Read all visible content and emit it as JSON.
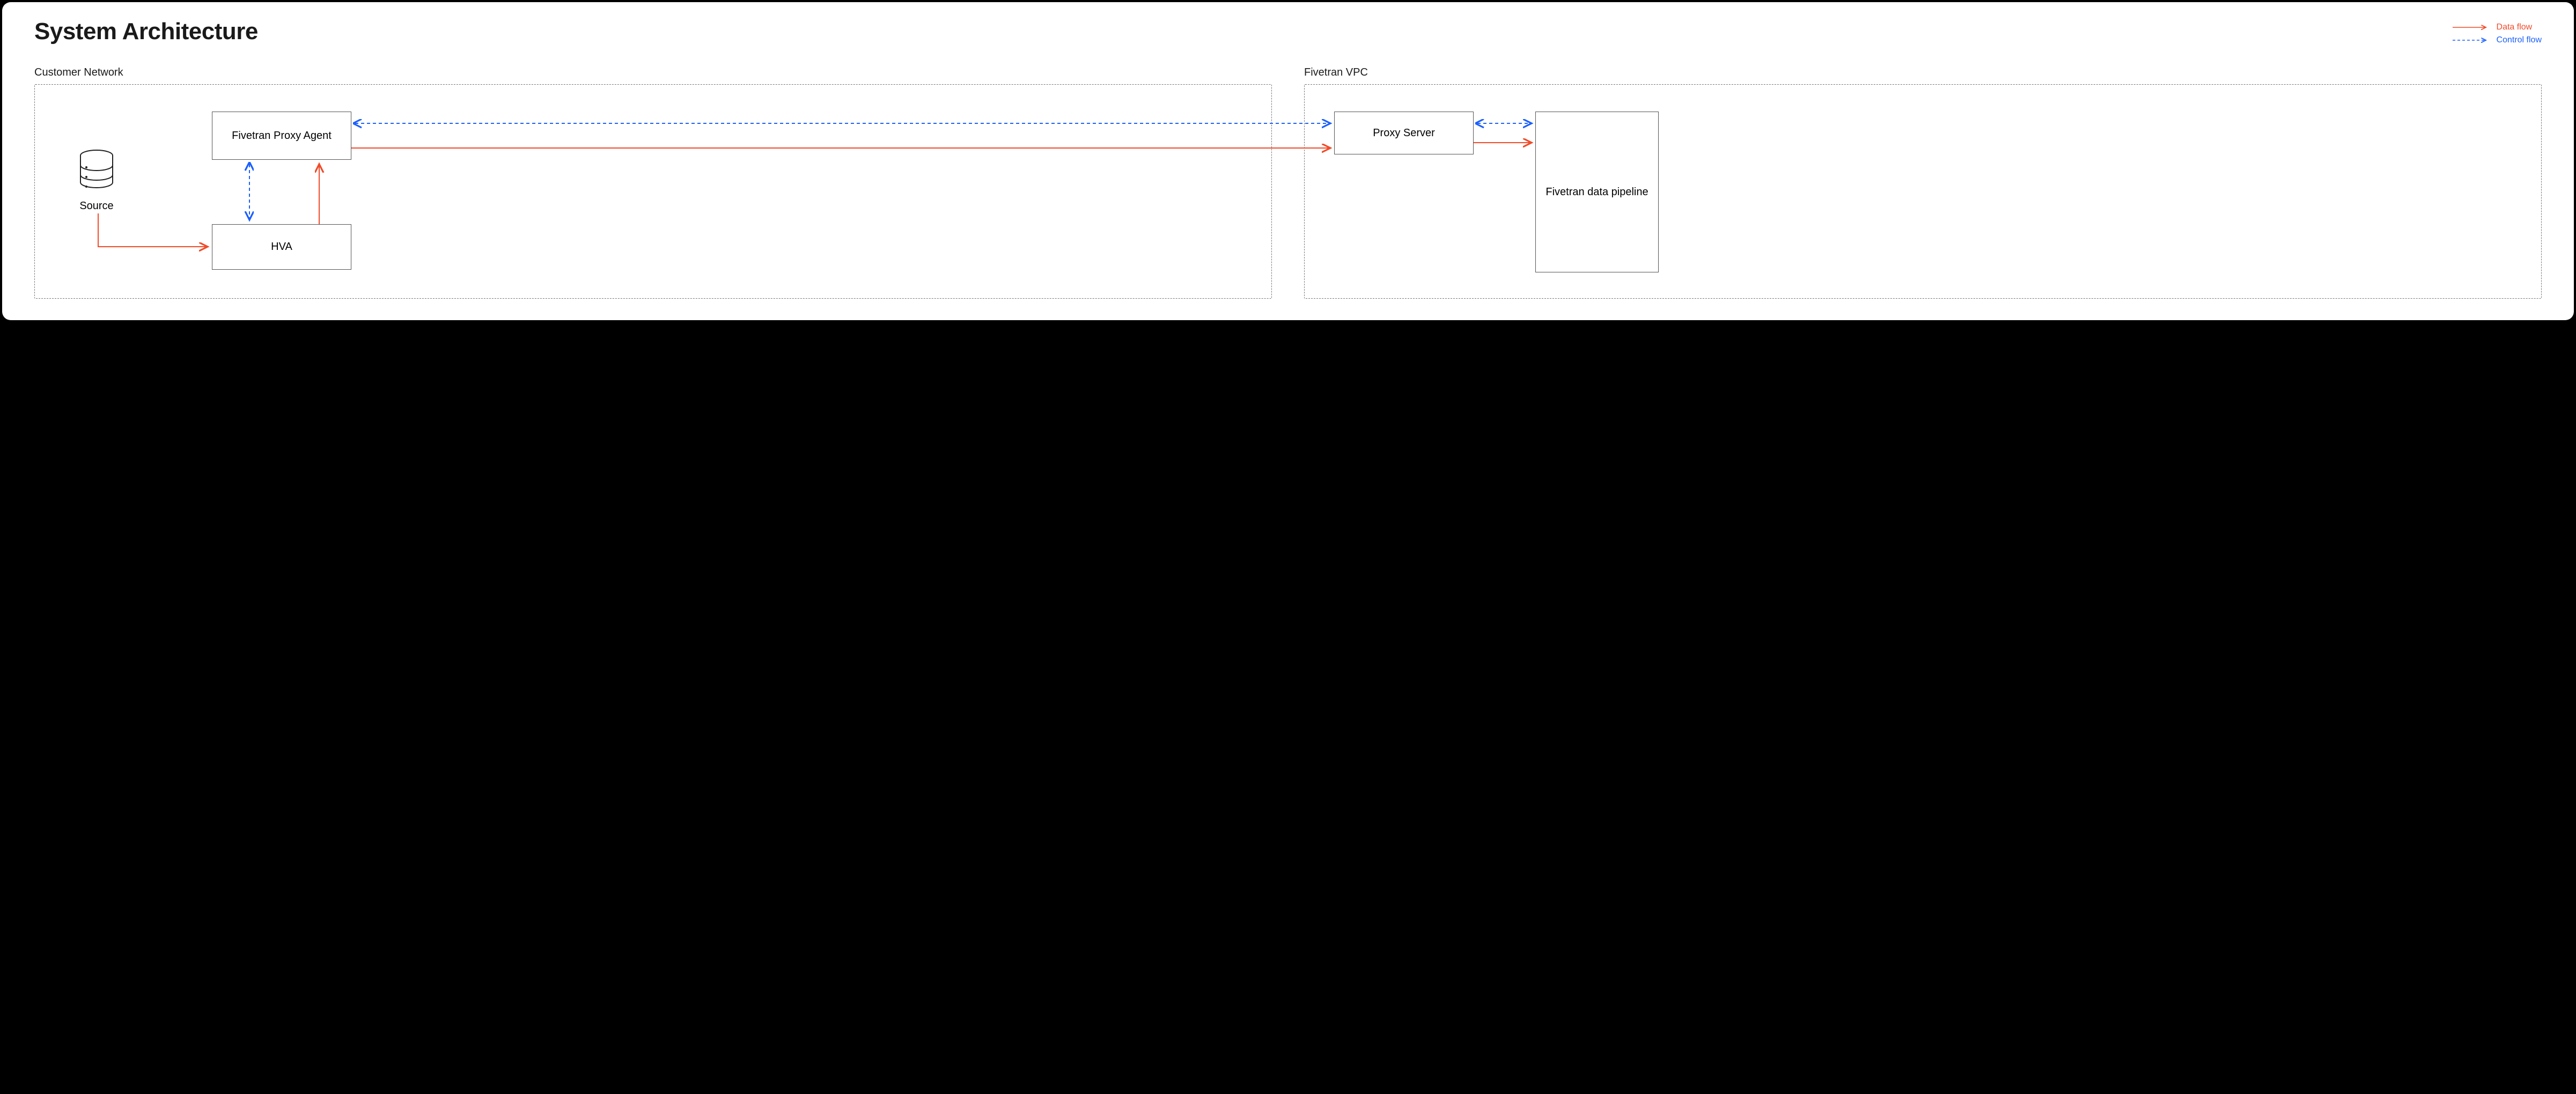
{
  "title": "System Architecture",
  "legend": {
    "data_flow": "Data flow",
    "control_flow": "Control flow"
  },
  "zones": {
    "customer": "Customer Network",
    "fivetran_vpc": "Fivetran VPC"
  },
  "nodes": {
    "source": "Source",
    "proxy_agent": "Fivetran Proxy Agent",
    "hva": "HVA",
    "proxy_server": "Proxy Server",
    "pipeline": "Fivetran data pipeline"
  },
  "colors": {
    "data": "#f04b29",
    "control": "#1a5fff"
  }
}
